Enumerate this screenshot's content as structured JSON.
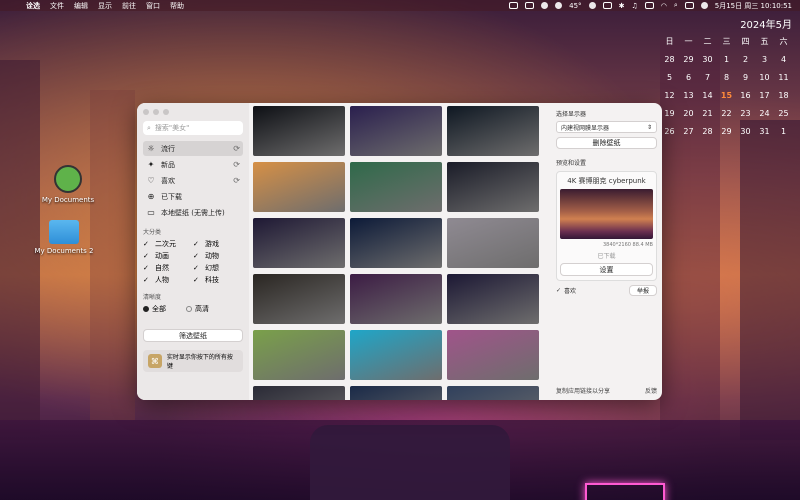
{
  "menubar": {
    "app_name": "诠选",
    "items": [
      "文件",
      "编辑",
      "显示",
      "前往",
      "窗口",
      "帮助"
    ],
    "temperature": "45°",
    "datetime": "5月15日 周三 10:10:51"
  },
  "calendar": {
    "title": "2024年5月",
    "weekdays": [
      "日",
      "一",
      "二",
      "三",
      "四",
      "五",
      "六"
    ],
    "rows": [
      [
        "28",
        "29",
        "30",
        "1",
        "2",
        "3",
        "4"
      ],
      [
        "5",
        "6",
        "7",
        "8",
        "9",
        "10",
        "11"
      ],
      [
        "12",
        "13",
        "14",
        "15",
        "16",
        "17",
        "18"
      ],
      [
        "19",
        "20",
        "21",
        "22",
        "23",
        "24",
        "25"
      ],
      [
        "26",
        "27",
        "28",
        "29",
        "30",
        "31",
        "1"
      ]
    ],
    "today": "15"
  },
  "desktop": {
    "icons": [
      {
        "label": "My Documents"
      },
      {
        "label": "My Documents 2"
      }
    ]
  },
  "sidebar": {
    "search_placeholder": "搜索\"美女\"",
    "nav": [
      {
        "label": "流行",
        "icon": "sun-icon"
      },
      {
        "label": "新品",
        "icon": "sparkle-icon"
      },
      {
        "label": "喜欢",
        "icon": "heart-icon"
      },
      {
        "label": "已下载",
        "icon": "download-icon"
      },
      {
        "label": "本地壁纸 (无需上传)",
        "icon": "monitor-icon"
      }
    ],
    "category_title": "大分类",
    "categories": [
      "二次元",
      "游戏",
      "动画",
      "动物",
      "自然",
      "幻想",
      "人物",
      "科技"
    ],
    "clarity_title": "清晰度",
    "clarity": {
      "all": "全部",
      "hd": "高清",
      "selected": "全部"
    },
    "filter_button": "筛选壁纸",
    "shortcut_text": "实时显示你按下的所有按键"
  },
  "right_panel": {
    "display_label": "选择显示器",
    "display_value": "内建视网膜显示器",
    "remove_button": "删除壁纸",
    "preview_label": "预览和设置",
    "preview_title": "4K 赛博朋克 cyberpunk",
    "preview_meta": "3840*2160 88.4 MB",
    "preview_state": "已下载",
    "set_button": "设置",
    "favorite_label": "喜欢",
    "report_button": "举报",
    "copy_link": "复制应用链接以分享",
    "feedback": "反馈"
  },
  "gallery_colors": [
    [
      "#0d0f14",
      "#2a1f4e",
      "#0e1722"
    ],
    [
      "#d69046",
      "#2f6a4a",
      "#1a1c28"
    ],
    [
      "#1e1834",
      "#0c1a38",
      "#8f8a92"
    ],
    [
      "#2a2622",
      "#3c1c44",
      "#1c1834"
    ],
    [
      "#7aa04a",
      "#1fa6c8",
      "#a0548a"
    ],
    [
      "#2a2a36",
      "#1a2a48",
      "#30405c"
    ]
  ],
  "colors": {
    "window_bg": "#f4f2f2",
    "sidebar_bg": "#ebe8e8",
    "today": "#ff8a3a"
  }
}
